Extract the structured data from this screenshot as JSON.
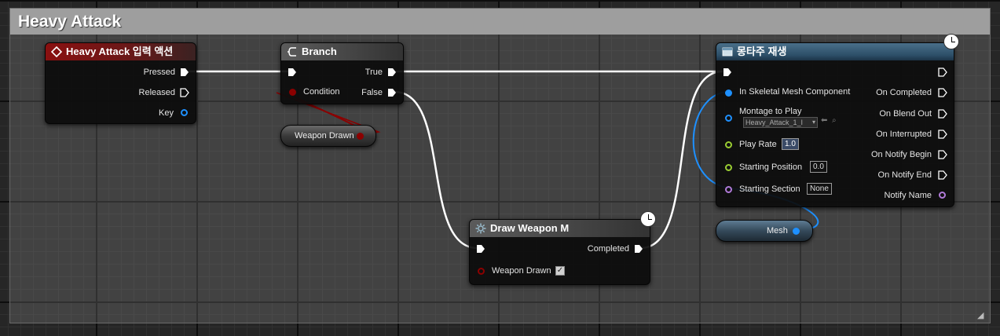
{
  "comment": {
    "title": "Heavy Attack"
  },
  "nodes": {
    "input_action": {
      "title": "Heavy Attack 입력 액션",
      "pins": {
        "pressed": "Pressed",
        "released": "Released",
        "key": "Key"
      }
    },
    "branch": {
      "title": "Branch",
      "pins": {
        "condition": "Condition",
        "true": "True",
        "false": "False"
      }
    },
    "weapon_var": {
      "label": "Weapon Drawn"
    },
    "draw_weapon": {
      "title": "Draw Weapon M",
      "pins": {
        "completed": "Completed",
        "weapon_drawn": "Weapon Drawn"
      },
      "weapon_drawn_checked": true
    },
    "montage": {
      "title": "몽타주 재생",
      "inputs": {
        "skeletal_mesh": "In Skeletal Mesh Component",
        "montage": "Montage to Play",
        "montage_value": "Heavy_Attack_1_I",
        "play_rate": "Play Rate",
        "play_rate_value": "1.0",
        "start_pos": "Starting Position",
        "start_pos_value": "0.0",
        "start_section": "Starting Section",
        "start_section_value": "None"
      },
      "outputs": {
        "completed": "On Completed",
        "blend_out": "On Blend Out",
        "interrupted": "On Interrupted",
        "notify_begin": "On Notify Begin",
        "notify_end": "On Notify End",
        "notify_name": "Notify Name"
      }
    },
    "mesh_var": {
      "label": "Mesh"
    }
  },
  "colors": {
    "exec": "#ffffff",
    "bool": "#8c0000",
    "object": "#1e90ff",
    "float": "#9acd32",
    "name": "#b07ad8"
  }
}
